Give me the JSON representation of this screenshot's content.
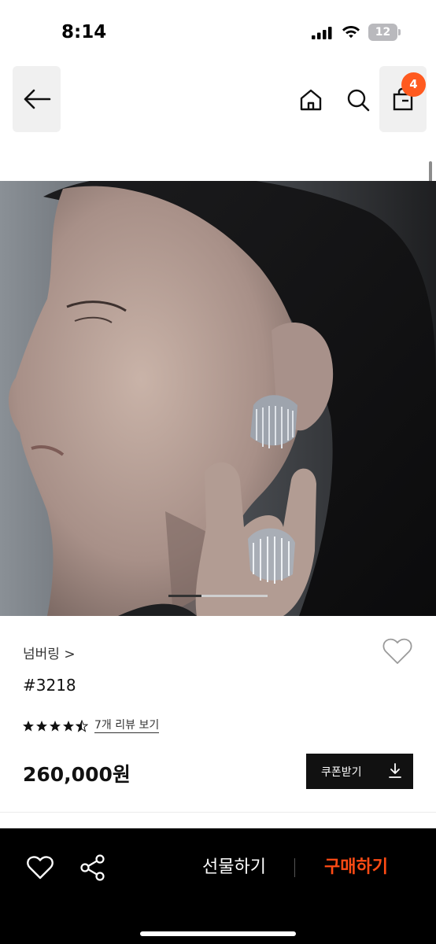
{
  "status_bar": {
    "time": "8:14",
    "battery": "12"
  },
  "nav": {
    "cart_count": "4"
  },
  "product": {
    "brand": "넘버링 >",
    "name": "#3218",
    "rating": 4.5,
    "review_link": "7개 리뷰 보기",
    "price": "260,000원",
    "coupon_label": "쿠폰받기"
  },
  "image": {
    "current_slide": 1,
    "slide_count": 3
  },
  "bottom_bar": {
    "gift_label": "선물하기",
    "buy_label": "구매하기"
  },
  "colors": {
    "accent": "#ff5a1f",
    "bottom_bar": "#000000",
    "dark_button": "#111111"
  }
}
